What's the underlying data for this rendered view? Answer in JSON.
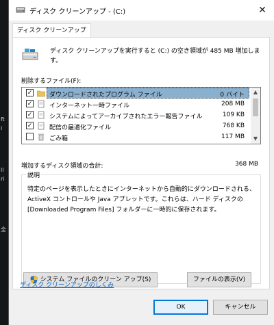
{
  "desktop": {
    "fragments": [
      "ft",
      "i",
      "ll",
      "ri",
      "全"
    ]
  },
  "window": {
    "title": "ディスク クリーンアップ - (C:)",
    "close_glyph": "✕"
  },
  "tabs": [
    {
      "label": "ディスク クリーンアップ"
    }
  ],
  "intro": "ディスク クリーンアップを実行すると (C:) の空き領域が 485 MB 増加します。",
  "files_label": "削除するファイル(F):",
  "files": [
    {
      "name": "ダウンロードされたプログラム ファイル",
      "size": "0 バイト",
      "checked": true,
      "selected": true
    },
    {
      "name": "インターネット一時ファイル",
      "size": "208 MB",
      "checked": true,
      "selected": false
    },
    {
      "name": "システムによってアーカイブされたエラー報告ファイル",
      "size": "109 KB",
      "checked": true,
      "selected": false
    },
    {
      "name": "配信の最適化ファイル",
      "size": "768 KB",
      "checked": true,
      "selected": false
    },
    {
      "name": "ごみ箱",
      "size": "117 MB",
      "checked": false,
      "selected": false
    }
  ],
  "total_label": "増加するディスク領域の合計:",
  "total_value": "368 MB",
  "description": {
    "title": "説明",
    "text": "特定のページを表示したときにインターネットから自動的にダウンロードされる、ActiveX コントロールや Java アプレットです。これらは、ハード ディスクの [Downloaded Program Files] フォルダーに一時的に保存されます。"
  },
  "buttons": {
    "cleanup_system": "システム ファイルのクリーン アップ(S)",
    "view_files": "ファイルの表示(V)",
    "ok": "OK",
    "cancel": "キャンセル"
  },
  "link": "ディスク クリーンアップのしくみ",
  "colors": {
    "selection": "#8ab0cf",
    "link": "#0066cc",
    "ok_border": "#0078d7"
  },
  "icons": {
    "title": "disk-cleanup-icon",
    "drive": "drive-icon",
    "shield": "uac-shield-icon"
  }
}
